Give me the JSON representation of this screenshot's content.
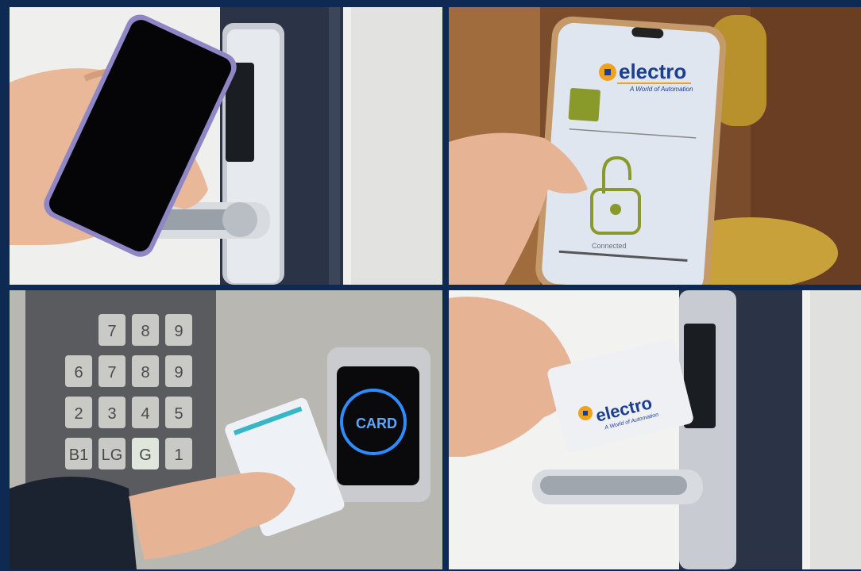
{
  "panels": {
    "phone_lock": {},
    "app_screen": {
      "brand": "electro",
      "tagline": "A World of Automation",
      "status": "Connected"
    },
    "keypad_card": {
      "keys": [
        "7",
        "8",
        "9",
        "6",
        "7",
        "8",
        "9",
        "2",
        "3",
        "4",
        "5",
        "B1",
        "LG",
        "G",
        "1"
      ],
      "reader_label": "CARD"
    },
    "card_lock": {
      "brand": "electro",
      "tagline": "A World of Automation"
    }
  },
  "colors": {
    "frame": "#0e2a52",
    "brand_blue": "#1c3e8f",
    "brand_orange": "#f0a21c",
    "unlock_green": "#8a9a2a",
    "reader_glow": "#2f8cff"
  },
  "icons": [
    "phone",
    "hand",
    "door-lever",
    "padlock-open",
    "keycard",
    "card-reader"
  ]
}
